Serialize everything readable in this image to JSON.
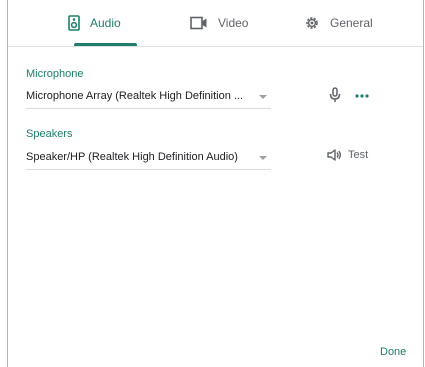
{
  "tabs": {
    "audio": {
      "label": "Audio",
      "icon": "speaker-device-icon",
      "active": true
    },
    "video": {
      "label": "Video",
      "icon": "video-camera-icon"
    },
    "general": {
      "label": "General",
      "icon": "gear-icon"
    }
  },
  "microphone": {
    "title": "Microphone",
    "selected": "Microphone Array (Realtek High Definition ...",
    "icons": [
      "microphone-icon",
      "more-options-icon"
    ]
  },
  "speakers": {
    "title": "Speakers",
    "selected": "Speaker/HP (Realtek High Definition Audio)",
    "test_label": "Test",
    "icon": "volume-icon"
  },
  "footer": {
    "done_label": "Done"
  },
  "colors": {
    "accent": "#1e7e6b",
    "muted": "#5f6368"
  }
}
